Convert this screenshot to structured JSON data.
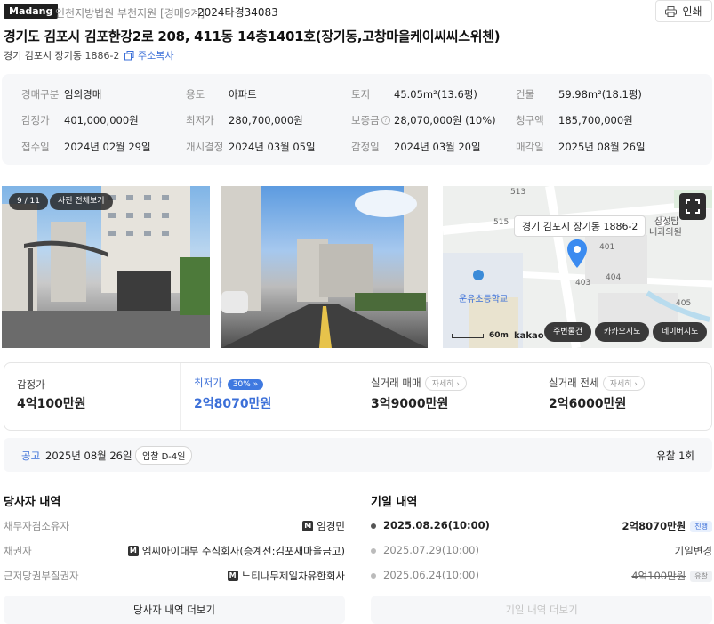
{
  "header": {
    "logo": "Madang",
    "court": "인천지방법원 부천지원 [경매9계]",
    "case_no": "2024타경34083",
    "print_label": "인쇄"
  },
  "address": {
    "title": "경기도 김포시 김포한강2로 208, 411동 14층1401호(장기동,고창마을케이씨씨스위첸)",
    "jibun": "경기 김포시 장기동 1886-2",
    "copy_label": "주소복사"
  },
  "info": {
    "auction_type": {
      "label": "경매구분",
      "value": "임의경매"
    },
    "use": {
      "label": "용도",
      "value": "아파트"
    },
    "land": {
      "label": "토지",
      "value": "45.05m²(13.6평)"
    },
    "building": {
      "label": "건물",
      "value": "59.98m²(18.1평)"
    },
    "appraisal": {
      "label": "감정가",
      "value": "401,000,000원"
    },
    "min_price": {
      "label": "최저가",
      "value": "280,700,000원"
    },
    "deposit": {
      "label": "보증금",
      "value": "28,070,000원 (10%)"
    },
    "claim": {
      "label": "청구액",
      "value": "185,700,000원"
    },
    "received": {
      "label": "접수일",
      "value": "2024년 02월 29일"
    },
    "started": {
      "label": "개시결정",
      "value": "2024년 03월 05일"
    },
    "appraisal_date": {
      "label": "감정일",
      "value": "2024년 03월 20일"
    },
    "sale_date": {
      "label": "매각일",
      "value": "2025년 08월 26일"
    }
  },
  "photos": {
    "counter": "9 / 11",
    "view_all": "사진 전체보기"
  },
  "map": {
    "label": "경기 김포시 장기동 1886-2",
    "numbers": [
      "513",
      "515",
      "401",
      "403",
      "404",
      "405"
    ],
    "school": "운유초등학교",
    "clinic1": "삼성탑",
    "clinic2": "내과의원",
    "scale": "60m",
    "brand": "kakao",
    "btn_nearby": "주변물건",
    "btn_kakao": "카카오지도",
    "btn_naver": "네이버지도"
  },
  "prices": {
    "appraisal_label": "감정가",
    "appraisal_value": "4억100만원",
    "min_label": "최저가",
    "min_pct": "30%",
    "min_value": "2억8070만원",
    "trade_label": "실거래 매매",
    "trade_value": "3억9000만원",
    "rent_label": "실거래 전세",
    "rent_value": "2억6000만원",
    "detail_chip": "자세히"
  },
  "notice": {
    "label": "공고",
    "date": "2025년 08월 26일",
    "dday": "입찰 D-4일",
    "fail": "유찰 1회"
  },
  "parties": {
    "title": "당사자 내역",
    "rows": [
      {
        "k": "채무자겸소유자",
        "v": "임경민"
      },
      {
        "k": "채권자",
        "v": "엠씨아이대부 주식회사(승계전:김포새마을금고)"
      },
      {
        "k": "근저당권부질권자",
        "v": "느티나무제일차유한회사"
      }
    ],
    "more": "당사자 내역 더보기"
  },
  "history": {
    "title": "기일 내역",
    "rows": [
      {
        "date": "2025.08.26(10:00)",
        "value": "2억8070만원",
        "status": "진행"
      },
      {
        "date": "2025.07.29(10:00)",
        "value": "기일변경",
        "status": ""
      },
      {
        "date": "2025.06.24(10:00)",
        "value": "4억100만원",
        "status": "유찰"
      }
    ],
    "more": "기일 내역 더보기"
  },
  "colors": {
    "accent": "#3b6fd8",
    "dark": "#1f1f1f",
    "bg": "#f6f7f9"
  }
}
